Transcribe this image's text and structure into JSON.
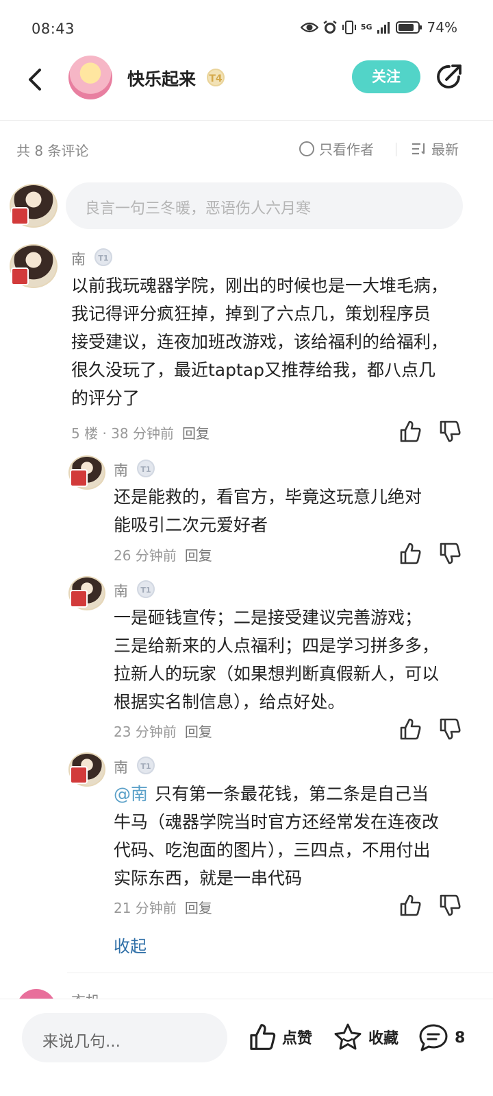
{
  "status_bar": {
    "time": "08:43",
    "network": "5G",
    "battery": "74%"
  },
  "header": {
    "username": "快乐起来",
    "level": "T4",
    "follow_label": "关注"
  },
  "comment_bar": {
    "count_label": "共 8 条评论",
    "only_author_label": "只看作者",
    "sort_label": "最新"
  },
  "comment_input": {
    "placeholder": "良言一句三冬暖，恶语伤人六月寒"
  },
  "comments": [
    {
      "name": "南",
      "level": "T1",
      "lines": [
        "以前我玩魂器学院，刚出的时候也是一大堆毛病，",
        "我记得评分疯狂掉，掉到了六点几，策划程序员",
        "接受建议，连夜加班改游戏，该给福利的给福利，",
        "很久没玩了，最近taptap又推荐给我，都八点几",
        "的评分了"
      ],
      "meta": "5 楼 · 38 分钟前",
      "reply_label": "回复"
    },
    {
      "name": "南",
      "level": "T1",
      "lines": [
        "还是能救的，看官方，毕竟这玩意儿绝对",
        "能吸引二次元爱好者"
      ],
      "meta": "26 分钟前",
      "reply_label": "回复"
    },
    {
      "name": "南",
      "level": "T1",
      "lines": [
        "一是砸钱宣传；二是接受建议完善游戏；",
        "三是给新来的人点福利；四是学习拼多多，",
        "拉新人的玩家（如果想判断真假新人，可以",
        "根据实名制信息），给点好处。"
      ],
      "meta": "23 分钟前",
      "reply_label": "回复"
    },
    {
      "name": "南",
      "level": "T1",
      "mention": "@南",
      "lines": [
        "只有第一条最花钱，第二条是自己当",
        "牛马（魂器学院当时官方还经常发在连夜改",
        "代码、吃泡面的图片），三四点，不用付出",
        "实际东西，就是一串代码"
      ],
      "meta": "21 分钟前",
      "reply_label": "回复"
    }
  ],
  "collapse_label": "收起",
  "next_comment": {
    "name": "衣机"
  },
  "bottom_bar": {
    "input_placeholder": "来说几句...",
    "like_label": "点赞",
    "favorite_label": "收藏",
    "comment_count": "8"
  }
}
